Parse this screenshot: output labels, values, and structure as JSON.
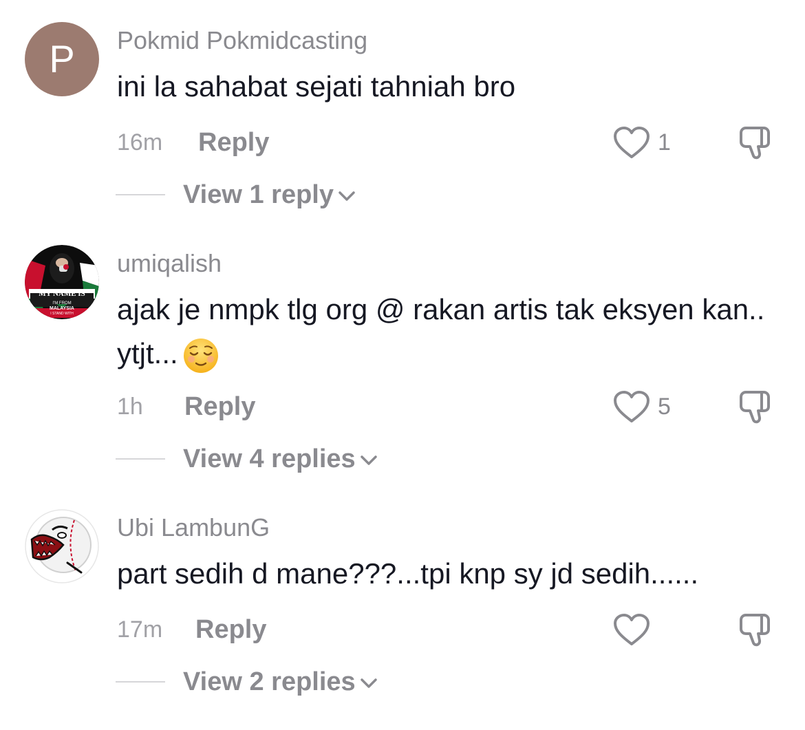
{
  "comments": [
    {
      "avatar_letter": "P",
      "username": "Pokmid Pokmidcasting",
      "text": "ini la sahabat sejati tahniah bro",
      "time": "16m",
      "reply_label": "Reply",
      "like_count": "1",
      "view_replies": "View 1 reply"
    },
    {
      "username": "umiqalish",
      "avatar_text_1": "MY NAME IS",
      "avatar_text_2": "I'M FROM",
      "avatar_text_3": "MALAYSIA",
      "avatar_text_4": "I STAND WITH",
      "text": "ajak je nmpk tlg org @ rakan artis tak eksyen kan.. ytjt...",
      "emoji": "relieved-face",
      "time": "1h",
      "reply_label": "Reply",
      "like_count": "5",
      "view_replies": "View 4 replies"
    },
    {
      "username": "Ubi LambunG",
      "text": "part sedih d mane???...tpi knp sy jd sedih......",
      "time": "17m",
      "reply_label": "Reply",
      "like_count": "",
      "view_replies": "View 2 replies"
    }
  ],
  "colors": {
    "avatar_bg": "#9c7b70",
    "meta_text": "#8a8a8f",
    "body_text": "#161823"
  }
}
